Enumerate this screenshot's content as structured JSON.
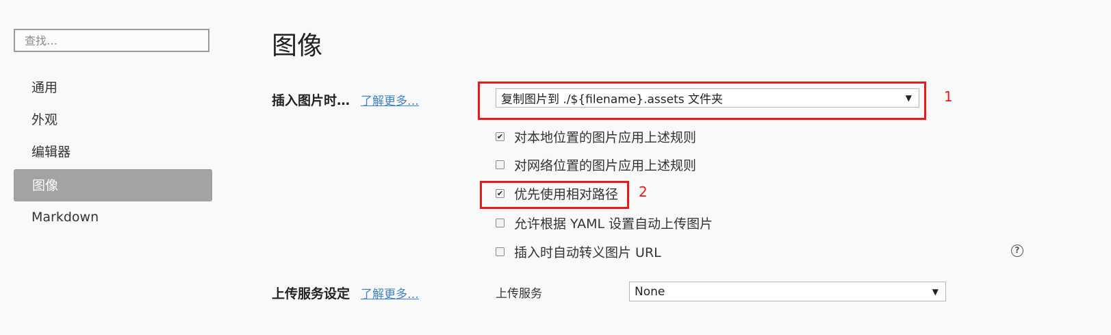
{
  "search": {
    "placeholder": "查找…"
  },
  "sidebar": {
    "items": [
      {
        "label": "通用"
      },
      {
        "label": "外观"
      },
      {
        "label": "编辑器"
      },
      {
        "label": "图像"
      },
      {
        "label": "Markdown"
      }
    ]
  },
  "main": {
    "title": "图像",
    "insert": {
      "label": "插入图片时…",
      "learn_more": "了解更多…",
      "selected": "复制图片到 ./${filename}.assets 文件夹",
      "caret": "▼",
      "options": [
        {
          "label": "对本地位置的图片应用上述规则",
          "checked": true
        },
        {
          "label": "对网络位置的图片应用上述规则",
          "checked": false
        },
        {
          "label": "优先使用相对路径",
          "checked": true
        },
        {
          "label": "允许根据 YAML 设置自动上传图片",
          "checked": false
        },
        {
          "label": "插入时自动转义图片 URL",
          "checked": false
        }
      ],
      "help": "?"
    },
    "upload": {
      "label": "上传服务设定",
      "learn_more": "了解更多…",
      "service_label": "上传服务",
      "service_value": "None",
      "caret": "▼"
    }
  },
  "annotations": {
    "marker_1": "1",
    "marker_2": "2",
    "color": "#e61b1b"
  },
  "colors": {
    "accent_link": "#4183c4",
    "active_nav_bg": "#a3a3a3",
    "background": "#f9f9f9"
  }
}
